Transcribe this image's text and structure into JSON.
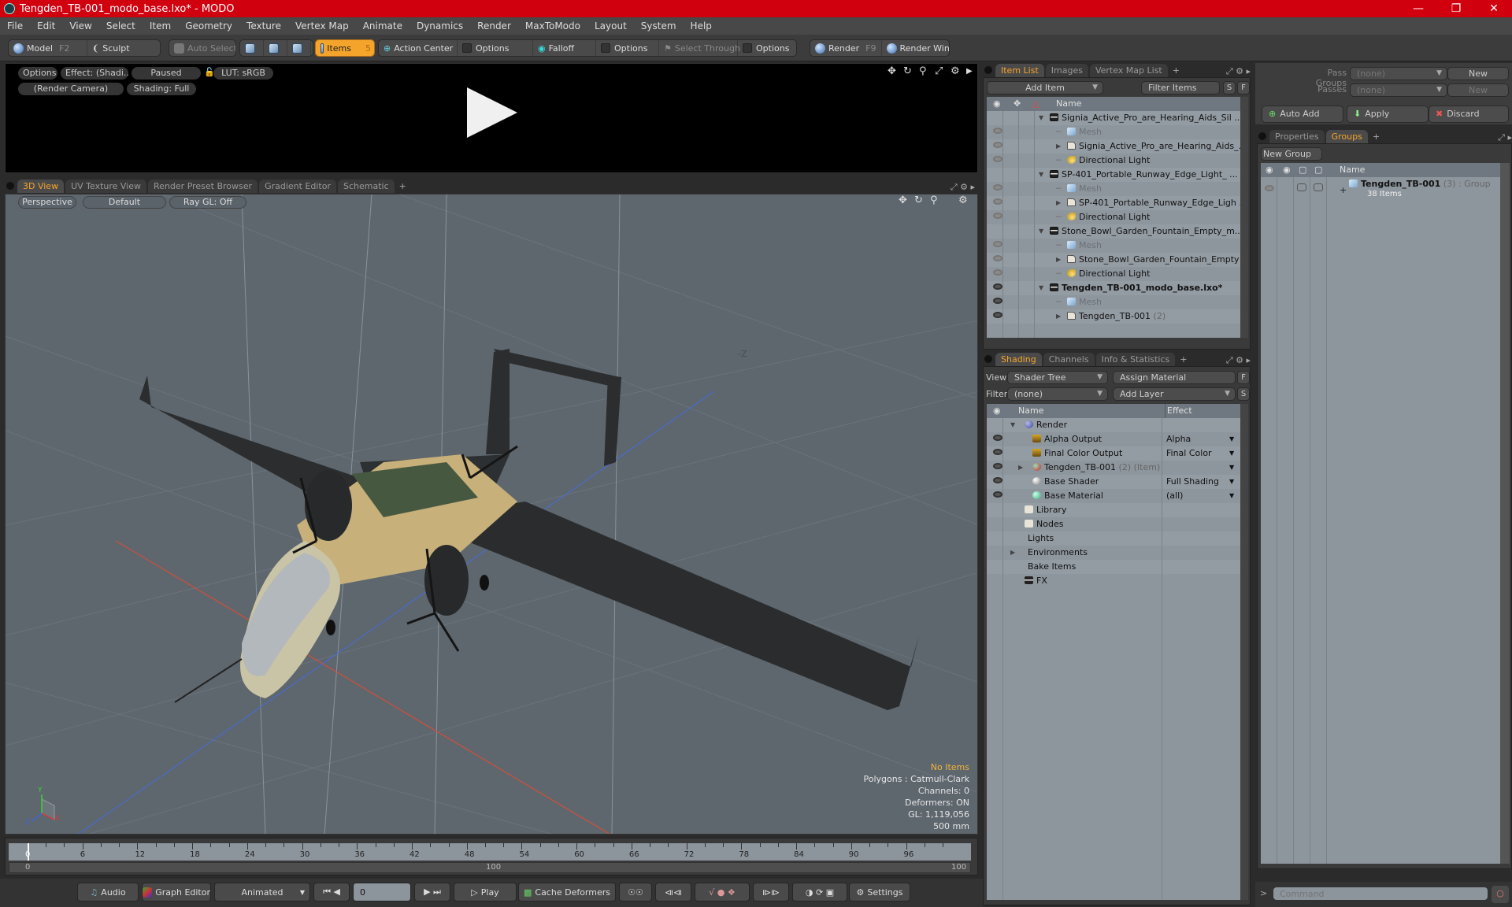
{
  "window": {
    "title": "Tengden_TB-001_modo_base.lxo* - MODO",
    "controls": [
      "minimize",
      "restore",
      "close"
    ]
  },
  "menu": [
    "File",
    "Edit",
    "View",
    "Select",
    "Item",
    "Geometry",
    "Texture",
    "Vertex Map",
    "Animate",
    "Dynamics",
    "Render",
    "MaxToModo",
    "Layout",
    "System",
    "Help"
  ],
  "toolbar": {
    "model": "Model",
    "model_key": "F2",
    "sculpt": "Sculpt",
    "auto_select": "Auto Select",
    "items": "Items",
    "items_key": "5",
    "action_center": "Action Center",
    "options1": "Options",
    "falloff": "Falloff",
    "options2": "Options",
    "select_through": "Select Through",
    "options3": "Options",
    "render": "Render",
    "render_key": "F9",
    "render_window": "Render Window"
  },
  "render_preview": {
    "options": "Options",
    "effect": "Effect: (Shadi...",
    "status": "Paused",
    "lut": "LUT: sRGB",
    "camera": "(Render Camera)",
    "shading": "Shading: Full"
  },
  "viewport": {
    "tabs": [
      "3D View",
      "UV Texture View",
      "Render Preset Browser",
      "Gradient Editor",
      "Schematic"
    ],
    "active_tab": 0,
    "view_mode": "Perspective",
    "style": "Default",
    "raygl": "Ray GL: Off",
    "axis_label": "-Z",
    "axes": {
      "x": "X",
      "y": "Y",
      "z": "Z"
    },
    "stats": {
      "selection": "No Items",
      "polygons": "Polygons : Catmull-Clark",
      "channels": "Channels: 0",
      "deformers": "Deformers: ON",
      "gl": "GL: 1,119,056",
      "scale": "500 mm"
    },
    "colors": {
      "bg": "#5e666e",
      "x_axis": "#d0483a",
      "z_axis": "#4a70c8",
      "accent": "#f4a42b"
    }
  },
  "timeline": {
    "ticks": [
      "0",
      "6",
      "12",
      "18",
      "24",
      "30",
      "36",
      "42",
      "48",
      "54",
      "60",
      "66",
      "72",
      "78",
      "84",
      "90",
      "96"
    ],
    "range_start": "0",
    "range_mid": "100",
    "range_end": "100"
  },
  "transport": {
    "audio": "Audio",
    "graph_editor": "Graph Editor",
    "mode": "Animated",
    "frame": "0",
    "play": "Play",
    "cache_deformers": "Cache Deformers",
    "settings": "Settings"
  },
  "item_list": {
    "tabs": [
      "Item List",
      "Images",
      "Vertex Map List"
    ],
    "active_tab": 0,
    "add_item": "Add Item",
    "filter": "Filter Items",
    "s": "S",
    "f": "F",
    "col_name": "Name",
    "rows": [
      {
        "label": "Signia_Active_Pro_are_Hearing_Aids_Sil ...",
        "type": "scene",
        "depth": 0,
        "expand": "open",
        "eye": "none"
      },
      {
        "label": "Mesh",
        "type": "mesh",
        "depth": 1,
        "eye": "dim",
        "muted": true
      },
      {
        "label": "Signia_Active_Pro_are_Hearing_Aids_...",
        "type": "group",
        "depth": 1,
        "expand": "closed",
        "eye": "dim"
      },
      {
        "label": "Directional Light",
        "type": "light",
        "depth": 1,
        "eye": "dim"
      },
      {
        "label": "SP-401_Portable_Runway_Edge_Light_ ...",
        "type": "scene",
        "depth": 0,
        "expand": "open",
        "eye": "none"
      },
      {
        "label": "Mesh",
        "type": "mesh",
        "depth": 1,
        "eye": "dim",
        "muted": true
      },
      {
        "label": "SP-401_Portable_Runway_Edge_Ligh ...",
        "type": "group",
        "depth": 1,
        "expand": "closed",
        "eye": "dim"
      },
      {
        "label": "Directional Light",
        "type": "light",
        "depth": 1,
        "eye": "dim"
      },
      {
        "label": "Stone_Bowl_Garden_Fountain_Empty_m...",
        "type": "scene",
        "depth": 0,
        "expand": "open",
        "eye": "none"
      },
      {
        "label": "Mesh",
        "type": "mesh",
        "depth": 1,
        "eye": "dim",
        "muted": true
      },
      {
        "label": "Stone_Bowl_Garden_Fountain_Empty ...",
        "type": "group",
        "depth": 1,
        "expand": "closed",
        "eye": "dim"
      },
      {
        "label": "Directional Light",
        "type": "light",
        "depth": 1,
        "eye": "dim"
      },
      {
        "label": "Tengden_TB-001_modo_base.lxo*",
        "type": "scene",
        "depth": 0,
        "expand": "open",
        "eye": "on",
        "bold": true
      },
      {
        "label": "Mesh",
        "type": "mesh",
        "depth": 1,
        "eye": "on",
        "muted": true
      },
      {
        "label": "Tengden_TB-001",
        "suffix": "(2)",
        "type": "group",
        "depth": 1,
        "expand": "closed",
        "eye": "on"
      }
    ]
  },
  "shading": {
    "tabs": [
      "Shading",
      "Channels",
      "Info & Statistics"
    ],
    "active_tab": 0,
    "view_label": "View",
    "view_value": "Shader Tree",
    "assign_material": "Assign Material",
    "f": "F",
    "filter_label": "Filter",
    "filter_value": "(none)",
    "add_layer": "Add Layer",
    "s": "S",
    "col_name": "Name",
    "col_effect": "Effect",
    "rows": [
      {
        "label": "Render",
        "icon": "render-sphere",
        "depth": 0,
        "expand": "open",
        "eye": false,
        "effect": ""
      },
      {
        "label": "Alpha Output",
        "icon": "output",
        "depth": 1,
        "eye": true,
        "effect": "Alpha",
        "dropdown": true
      },
      {
        "label": "Final Color Output",
        "icon": "output",
        "depth": 1,
        "eye": true,
        "effect": "Final Color",
        "dropdown": true
      },
      {
        "label": "Tengden_TB-001",
        "suffix": "(2) (Item)",
        "icon": "material-group",
        "depth": 1,
        "expand": "closed",
        "eye": true,
        "effect": "",
        "dropdown": true
      },
      {
        "label": "Base Shader",
        "icon": "shader",
        "depth": 1,
        "eye": true,
        "effect": "Full Shading",
        "dropdown": true
      },
      {
        "label": "Base Material",
        "icon": "material",
        "depth": 1,
        "eye": true,
        "effect": "(all)",
        "dropdown": true
      },
      {
        "label": "Library",
        "icon": "folder",
        "depth": 0,
        "eye": false,
        "effect": ""
      },
      {
        "label": "Nodes",
        "icon": "folder",
        "depth": 0,
        "eye": false,
        "effect": ""
      },
      {
        "label": "Lights",
        "icon": "none",
        "depth": 0,
        "eye": false,
        "effect": ""
      },
      {
        "label": "Environments",
        "icon": "none",
        "depth": 0,
        "expand": "closed",
        "eye": false,
        "effect": ""
      },
      {
        "label": "Bake Items",
        "icon": "none",
        "depth": 0,
        "eye": false,
        "effect": ""
      },
      {
        "label": "FX",
        "icon": "clapper",
        "depth": 0,
        "eye": false,
        "effect": ""
      }
    ]
  },
  "passes": {
    "pass_groups_label": "Pass Groups",
    "pass_groups_value": "(none)",
    "new1": "New",
    "passes_label": "Passes",
    "passes_value": "(none)",
    "new2": "New",
    "auto_add": "Auto Add",
    "apply": "Apply",
    "discard": "Discard"
  },
  "groups": {
    "tabs": [
      "Properties",
      "Groups"
    ],
    "active_tab": 1,
    "new_group": "New Group",
    "col_name": "Name",
    "rows": [
      {
        "label": "Tengden_TB-001",
        "count": "(3)",
        "type": ": Group",
        "items": "38 Items"
      }
    ]
  },
  "command": {
    "prompt": ">",
    "placeholder": "Command"
  }
}
